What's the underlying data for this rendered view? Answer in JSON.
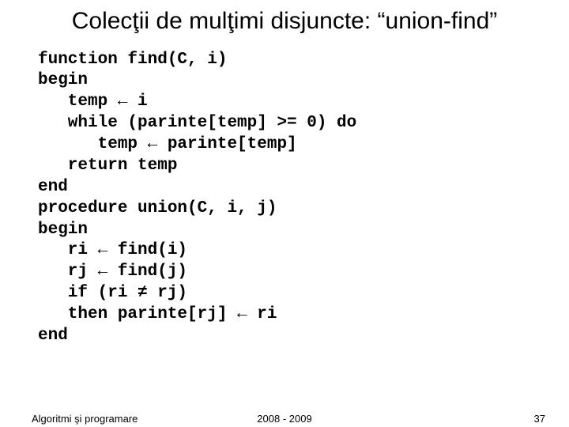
{
  "title": "Colecţii de mulţimi disjuncte: “union-find”",
  "code": "function find(C, i)\nbegin\n   temp ← i\n   while (parinte[temp] >= 0) do\n      temp ← parinte[temp]\n   return temp\nend\nprocedure union(C, i, j)\nbegin\n   ri ← find(i)\n   rj ← find(j)\n   if (ri ≠ rj)\n   then parinte[rj] ← ri\nend",
  "footer": {
    "left": "Algoritmi şi programare",
    "center": "2008 - 2009",
    "right": "37"
  }
}
